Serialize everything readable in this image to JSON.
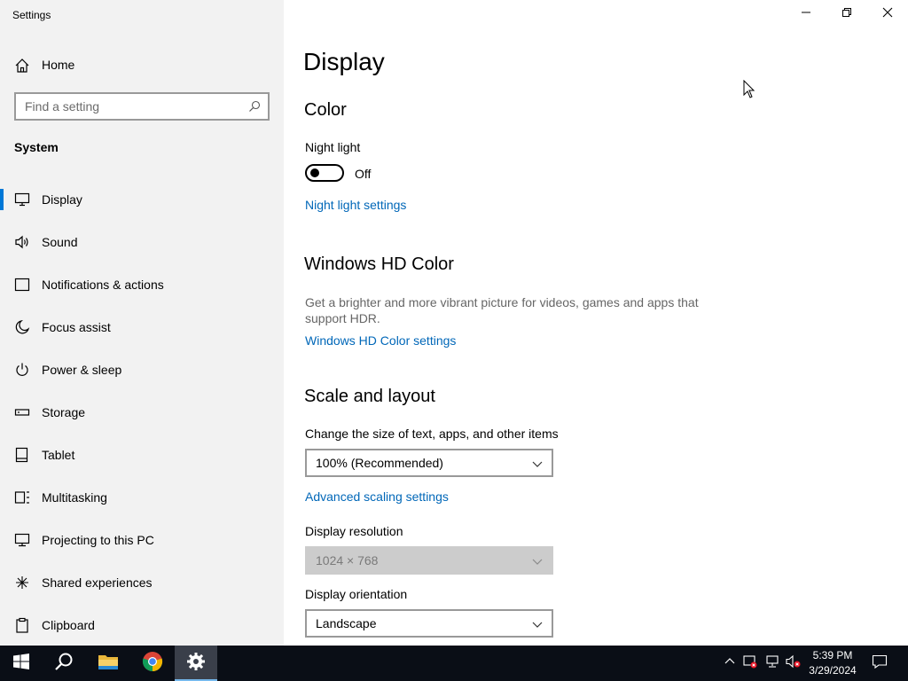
{
  "window": {
    "title": "Settings",
    "controls": {
      "minimize": "minimize-icon",
      "restore": "restore-icon",
      "close": "close-icon"
    }
  },
  "sidebar": {
    "home_label": "Home",
    "search_placeholder": "Find a setting",
    "section_label": "System",
    "items": [
      {
        "label": "Display",
        "icon": "monitor-icon",
        "selected": true
      },
      {
        "label": "Sound",
        "icon": "speaker-icon"
      },
      {
        "label": "Notifications & actions",
        "icon": "notification-icon"
      },
      {
        "label": "Focus assist",
        "icon": "moon-icon"
      },
      {
        "label": "Power & sleep",
        "icon": "power-icon"
      },
      {
        "label": "Storage",
        "icon": "storage-icon"
      },
      {
        "label": "Tablet",
        "icon": "tablet-icon"
      },
      {
        "label": "Multitasking",
        "icon": "multitasking-icon"
      },
      {
        "label": "Projecting to this PC",
        "icon": "projecting-icon"
      },
      {
        "label": "Shared experiences",
        "icon": "shared-experiences-icon"
      },
      {
        "label": "Clipboard",
        "icon": "clipboard-icon"
      }
    ]
  },
  "main": {
    "title": "Display",
    "color": {
      "heading": "Color",
      "night_light_label": "Night light",
      "night_light_state": "Off",
      "night_light_settings_link": "Night light settings"
    },
    "hd_color": {
      "heading": "Windows HD Color",
      "description": "Get a brighter and more vibrant picture for videos, games and apps that support HDR.",
      "settings_link": "Windows HD Color settings"
    },
    "scale_layout": {
      "heading": "Scale and layout",
      "size_label": "Change the size of text, apps, and other items",
      "size_value": "100% (Recommended)",
      "advanced_link": "Advanced scaling settings",
      "resolution_label": "Display resolution",
      "resolution_value": "1024 × 768",
      "orientation_label": "Display orientation",
      "orientation_value": "Landscape"
    }
  },
  "taskbar": {
    "apps": [
      "start-icon",
      "search-icon",
      "file-explorer-icon",
      "chrome-icon",
      "settings-icon"
    ],
    "active_app": "settings-icon",
    "clock_time": "5:39 PM",
    "clock_date": "3/29/2024"
  },
  "colors": {
    "accent": "#0078d7",
    "link": "#0067b8",
    "sidebar_bg": "#f2f2f2",
    "taskbar_bg": "#0a0e16"
  }
}
